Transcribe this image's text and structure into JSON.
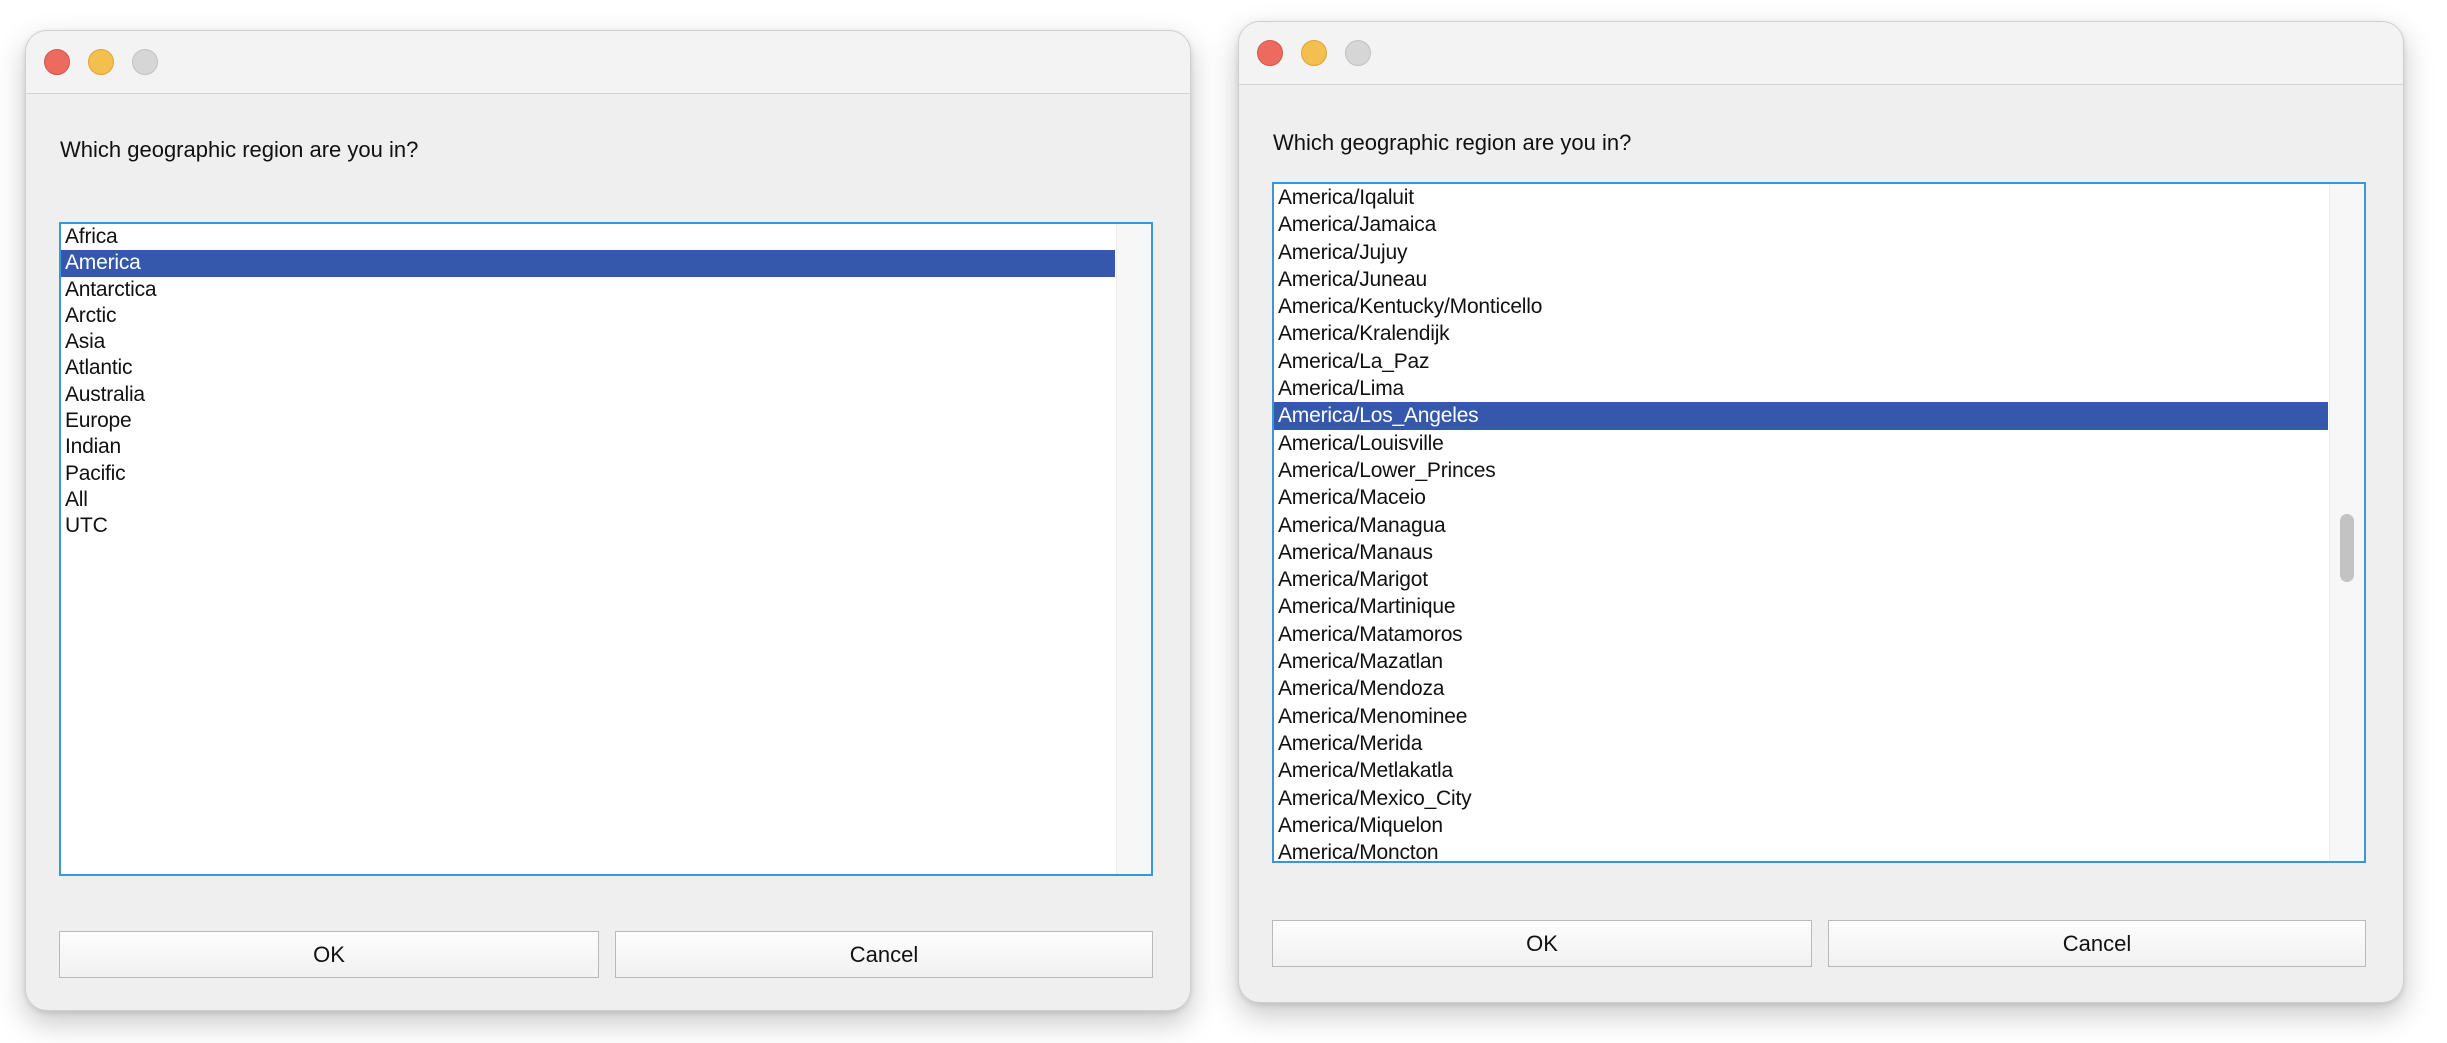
{
  "dialogs": [
    {
      "prompt": "Which geographic region are you in?",
      "items": [
        "Africa",
        "America",
        "Antarctica",
        "Arctic",
        "Asia",
        "Atlantic",
        "Australia",
        "Europe",
        "Indian",
        "Pacific",
        "All",
        "UTC"
      ],
      "selected_index": 1,
      "ok_label": "OK",
      "cancel_label": "Cancel"
    },
    {
      "prompt": "Which geographic region are you in?",
      "items": [
        "America/Iqaluit",
        "America/Jamaica",
        "America/Jujuy",
        "America/Juneau",
        "America/Kentucky/Monticello",
        "America/Kralendijk",
        "America/La_Paz",
        "America/Lima",
        "America/Los_Angeles",
        "America/Louisville",
        "America/Lower_Princes",
        "America/Maceio",
        "America/Managua",
        "America/Manaus",
        "America/Marigot",
        "America/Martinique",
        "America/Matamoros",
        "America/Mazatlan",
        "America/Mendoza",
        "America/Menominee",
        "America/Merida",
        "America/Metlakatla",
        "America/Mexico_City",
        "America/Miquelon",
        "America/Moncton"
      ],
      "selected_index": 8,
      "ok_label": "OK",
      "cancel_label": "Cancel"
    }
  ],
  "colors": {
    "selection": "#3658ac",
    "listbox_border": "#3b95d9",
    "close": "#ed6a5e",
    "minimize": "#f5bf4f",
    "zoom_disabled": "#d6d6d7"
  }
}
